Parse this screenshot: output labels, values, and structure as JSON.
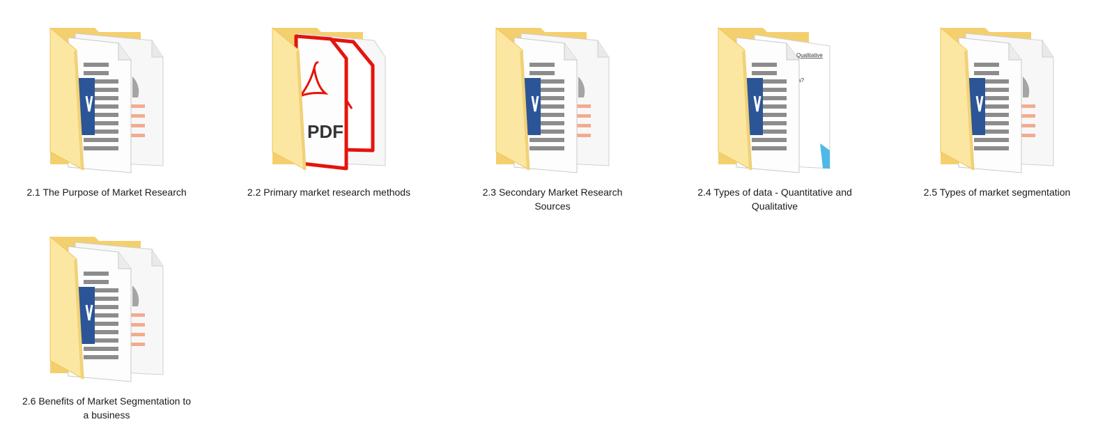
{
  "explorer": {
    "items": [
      {
        "name": "2.1 The Purpose of Market Research",
        "icon": "folder-word-icon"
      },
      {
        "name": "2.2 Primary market research methods",
        "icon": "folder-pdf-icon"
      },
      {
        "name": "2.3 Secondary Market Research Sources",
        "icon": "folder-word-icon"
      },
      {
        "name": "2.4 Types of data - Quantitative and Qualitative",
        "icon": "folder-doc-preview-icon",
        "preview_text": [
          "Qualitative",
          "a?"
        ]
      },
      {
        "name": "2.5 Types of market segmentation",
        "icon": "folder-word-icon"
      },
      {
        "name": "2.6 Benefits of Market Segmentation to a business",
        "icon": "folder-word-icon"
      }
    ]
  },
  "colors": {
    "folder_back": "#f4cf6e",
    "folder_front": "#fce7a2",
    "folder_front_edge": "#eec65b",
    "word_blue": "#2b5597",
    "pdf_red": "#e5140c",
    "line_gray": "#8c8c8c",
    "accent_orange": "#f3ab8f",
    "label_text": "#1a1a1a"
  }
}
